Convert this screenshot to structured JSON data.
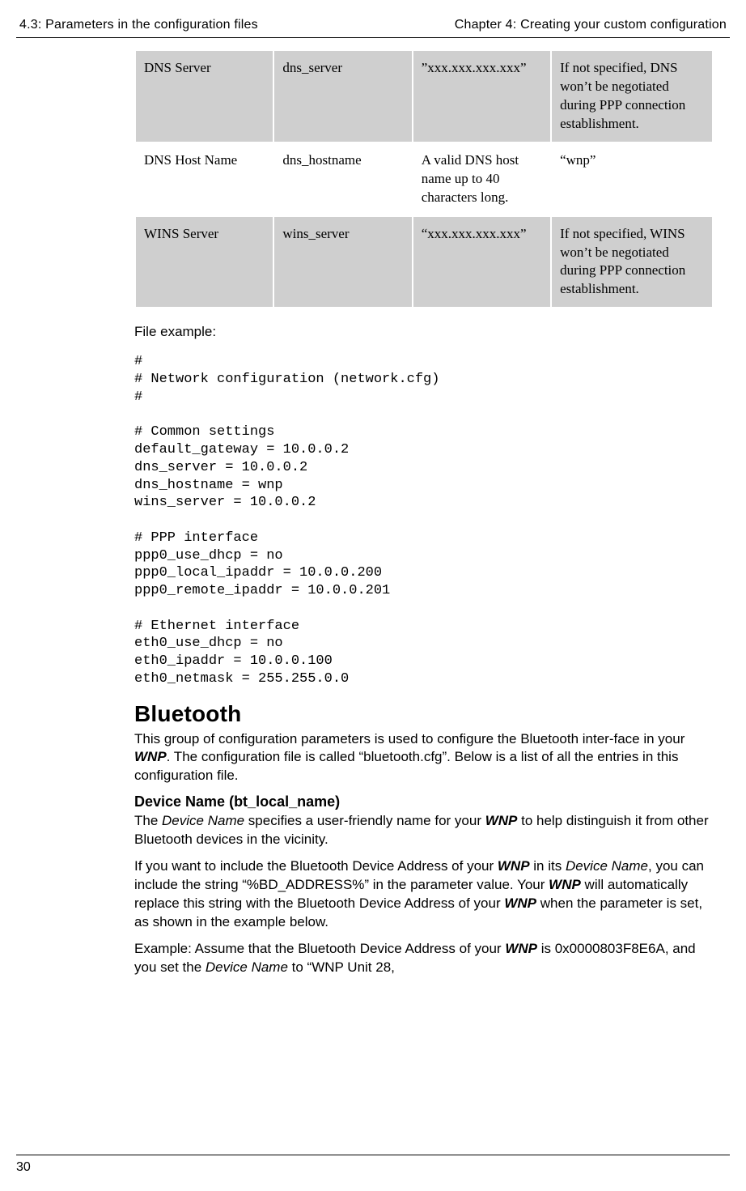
{
  "header": {
    "left": "4.3: Parameters in the configuration files",
    "right": "Chapter 4: Creating your custom configuration"
  },
  "table": {
    "rows": [
      {
        "shaded": true,
        "c1": "DNS Server",
        "c2": "dns_server",
        "c3": "”xxx.xxx.xxx.xxx”",
        "c4": "If not specified, DNS won’t be negotiated during PPP connection establishment."
      },
      {
        "shaded": false,
        "c1": "DNS Host Name",
        "c2": "dns_hostname",
        "c3": "A valid DNS host name up to 40 characters long.",
        "c4": "“wnp”"
      },
      {
        "shaded": true,
        "c1": "WINS Server",
        "c2": "wins_server",
        "c3": "“xxx.xxx.xxx.xxx”",
        "c4": "If not specified, WINS won’t be negotiated during PPP connection establishment."
      }
    ]
  },
  "file_example_label": "File example:",
  "code": "#\n# Network configuration (network.cfg)\n#\n\n# Common settings\ndefault_gateway = 10.0.0.2\ndns_server = 10.0.0.2\ndns_hostname = wnp\nwins_server = 10.0.0.2\n\n# PPP interface\nppp0_use_dhcp = no\nppp0_local_ipaddr = 10.0.0.200\nppp0_remote_ipaddr = 10.0.0.201\n\n# Ethernet interface\neth0_use_dhcp = no\neth0_ipaddr = 10.0.0.100\neth0_netmask = 255.255.0.0",
  "section": {
    "title": "Bluetooth",
    "intro_a": "This group of configuration parameters is used to configure the Bluetooth inter-face in your ",
    "intro_b": ". The configuration file is called “bluetooth.cfg”. Below is a list of all the entries in this configuration file.",
    "wnp": "WNP",
    "sub1_title": "Device Name (bt_local_name)",
    "sub1_p1_a": "The ",
    "sub1_p1_dn": "Device Name",
    "sub1_p1_b": " specifies a user-friendly name for your ",
    "sub1_p1_c": " to help distinguish it from other Bluetooth devices in the vicinity.",
    "sub1_p2_a": "If you want to include the Bluetooth Device Address of your ",
    "sub1_p2_b": " in its ",
    "sub1_p2_c": ", you can include the string “%BD_ADDRESS%” in the parameter value. Your ",
    "sub1_p2_d": " will automatically replace this string with the Bluetooth Device Address of your ",
    "sub1_p2_e": " when the parameter is set, as shown in the example below.",
    "sub1_p3_a": "Example: Assume that the Bluetooth Device Address of your ",
    "sub1_p3_b": " is 0x0000803F8E6A, and you set the ",
    "sub1_p3_c": " to “WNP Unit 28,"
  },
  "page_number": "30"
}
